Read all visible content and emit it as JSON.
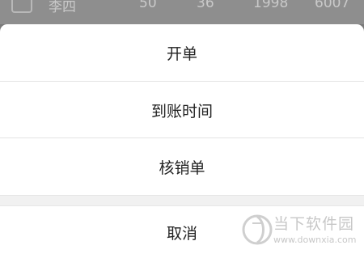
{
  "background_row": {
    "name": "李四",
    "values": [
      "50",
      "36",
      "1998",
      "6007"
    ]
  },
  "action_sheet": {
    "items": [
      {
        "label": "开单"
      },
      {
        "label": "到账时间"
      },
      {
        "label": "核销单"
      }
    ],
    "cancel_label": "取消"
  },
  "watermark": {
    "title": "当下软件园",
    "url": "www.downxia.com"
  },
  "colors": {
    "overlay": "#7a7a7a",
    "sheet_background": "#ffffff",
    "text": "#222222",
    "divider": "#e4e4e4"
  }
}
